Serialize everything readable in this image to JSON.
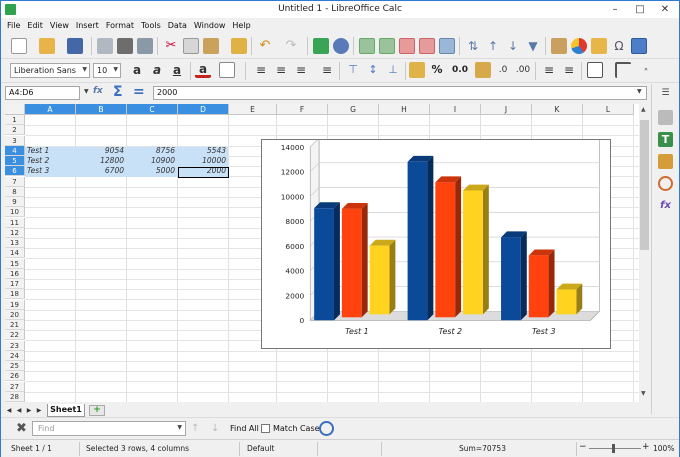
{
  "window": {
    "title": "Untitled 1 - LibreOffice Calc"
  },
  "menu": [
    "File",
    "Edit",
    "View",
    "Insert",
    "Format",
    "Tools",
    "Data",
    "Window",
    "Help"
  ],
  "toolbar": {
    "font_name": "Liberation Sans",
    "font_size": "10",
    "percent_label": "%",
    "decimal_label": "0.0"
  },
  "formula": {
    "cell_ref": "A4:D6",
    "content": "2000"
  },
  "columns": [
    "A",
    "B",
    "C",
    "D",
    "E",
    "F",
    "G",
    "H",
    "I",
    "J",
    "K",
    "L"
  ],
  "rows": [
    "1",
    "2",
    "3",
    "4",
    "5",
    "6",
    "7",
    "8",
    "9",
    "10",
    "11",
    "12",
    "13",
    "14",
    "15",
    "16",
    "17",
    "18",
    "19",
    "20",
    "21",
    "22",
    "23",
    "24",
    "25",
    "26",
    "27",
    "28"
  ],
  "cells": [
    {
      "label": "Test 1",
      "b": "9054",
      "c": "8756",
      "d": "5543"
    },
    {
      "label": "Test 2",
      "b": "12800",
      "c": "10900",
      "d": "10000"
    },
    {
      "label": "Test 3",
      "b": "6700",
      "c": "5000",
      "d": "2000"
    }
  ],
  "chart_data": {
    "type": "bar",
    "categories": [
      "Test 1",
      "Test 2",
      "Test 3"
    ],
    "series": [
      {
        "values": [
          9054,
          12800,
          6700
        ],
        "color": "#0b4a99"
      },
      {
        "values": [
          8756,
          10900,
          5000
        ],
        "color": "#ff420e"
      },
      {
        "values": [
          5543,
          10000,
          2000
        ],
        "color": "#ffd320"
      }
    ],
    "ylim": [
      0,
      14000
    ],
    "yticks": [
      "0",
      "2000",
      "4000",
      "6000",
      "8000",
      "10000",
      "12000",
      "14000"
    ],
    "grid": true,
    "three_d": true
  },
  "sheets": {
    "active": "Sheet1"
  },
  "find": {
    "placeholder": "Find",
    "find_all": "Find All",
    "match_case": "Match Case"
  },
  "status": {
    "sheet": "Sheet 1 / 1",
    "selection": "Selected 3 rows, 4 columns",
    "style": "Default",
    "sum": "Sum=70753",
    "zoom": "100%"
  },
  "colors": {
    "selection": "#c9e1f7",
    "header_selected": "#3a8fe0",
    "window_border": "#2e7bcf"
  }
}
